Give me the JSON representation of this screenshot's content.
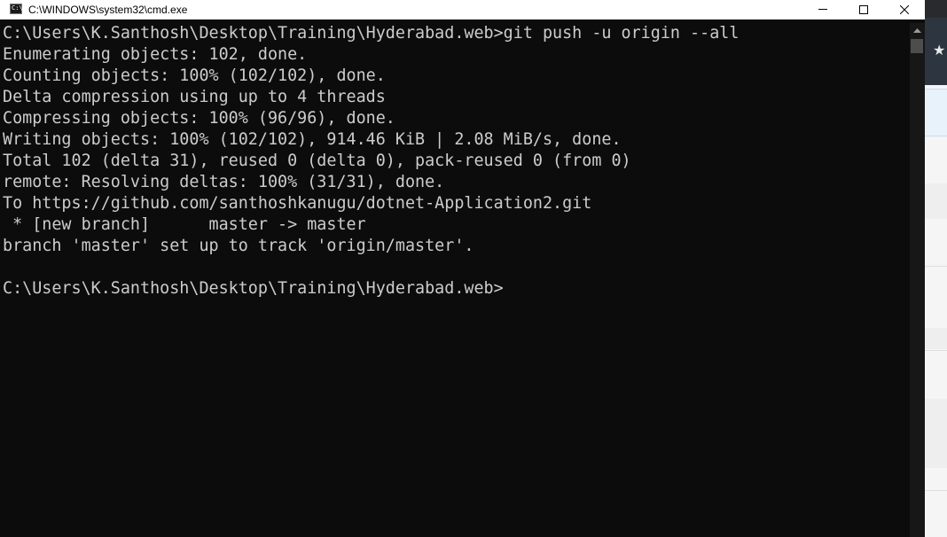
{
  "window": {
    "title": "C:\\WINDOWS\\system32\\cmd.exe",
    "icon_text": "C:\\",
    "controls": {
      "minimize_icon": "minimize-icon",
      "maximize_icon": "maximize-icon",
      "close_icon": "close-icon"
    }
  },
  "console": {
    "lines": [
      "C:\\Users\\K.Santhosh\\Desktop\\Training\\Hyderabad.web>git push -u origin --all",
      "Enumerating objects: 102, done.",
      "Counting objects: 100% (102/102), done.",
      "Delta compression using up to 4 threads",
      "Compressing objects: 100% (96/96), done.",
      "Writing objects: 100% (102/102), 914.46 KiB | 2.08 MiB/s, done.",
      "Total 102 (delta 31), reused 0 (delta 0), pack-reused 0 (from 0)",
      "remote: Resolving deltas: 100% (31/31), done.",
      "To https://github.com/santhoshkanugu/dotnet-Application2.git",
      " * [new branch]      master -> master",
      "branch 'master' set up to track 'origin/master'.",
      "",
      "C:\\Users\\K.Santhosh\\Desktop\\Training\\Hyderabad.web>"
    ]
  },
  "background_window": {
    "star_icon": "★"
  },
  "colors": {
    "console_bg": "#0c0c0c",
    "console_text": "#cccccc",
    "titlebar_bg": "#ffffff"
  }
}
